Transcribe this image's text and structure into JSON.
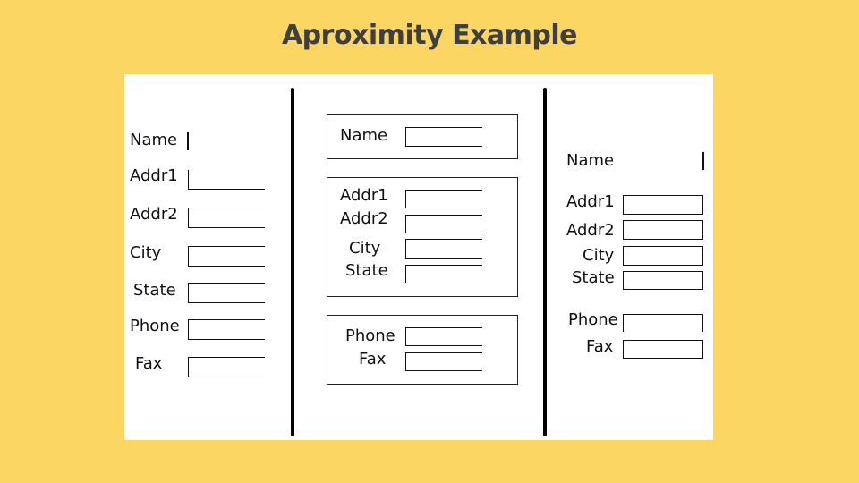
{
  "title": "Aproximity Example",
  "left_form": {
    "labels": [
      "Name",
      "Addr1",
      "Addr2",
      "City",
      "State",
      "Phone",
      "Fax"
    ]
  },
  "middle_form": {
    "name_group": {
      "labels": [
        "Name"
      ]
    },
    "address_group": {
      "labels": [
        "Addr1",
        "Addr2",
        "City",
        "State"
      ]
    },
    "contact_group": {
      "labels": [
        "Phone",
        "Fax"
      ]
    }
  },
  "right_form": {
    "labels": [
      "Name",
      "Addr1",
      "Addr2",
      "City",
      "State",
      "Phone",
      "Fax"
    ]
  },
  "colors": {
    "background": "#FCD663",
    "panel": "#FFFFFF",
    "title": "#3F3F3F",
    "lines": "#000000"
  }
}
